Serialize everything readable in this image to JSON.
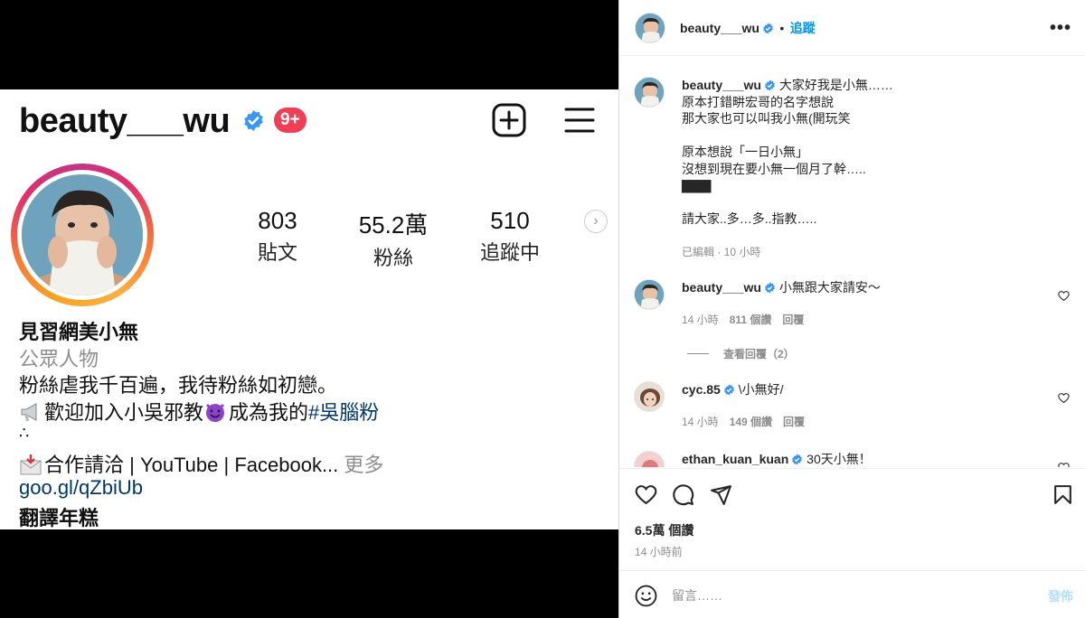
{
  "profile": {
    "username": "beauty___wu",
    "notifications": "9+",
    "stats": [
      {
        "value": "803",
        "label": "貼文"
      },
      {
        "value": "55.2萬",
        "label": "粉絲"
      },
      {
        "value": "510",
        "label": "追蹤中"
      }
    ],
    "display_name": "見習網美小無",
    "category": "公眾人物",
    "bio_line1": "粉絲虐我千百遍，我待粉絲如初戀。",
    "bio_line2_text": "歡迎加入小吳邪教",
    "bio_line2_text2": "成為我的",
    "bio_hashtag": "#吳腦粉",
    "bio_line3": "∴",
    "bio_line4_text": "合作請洽 | YouTube | Facebook...",
    "bio_more": " 更多",
    "link": "goo.gl/qZbiUb",
    "translate": "翻譯年糕",
    "next_arrow": "›"
  },
  "post": {
    "header": {
      "username": "beauty___wu",
      "follow": "追蹤",
      "more": "•••"
    },
    "caption": {
      "username": "beauty___wu",
      "text": "大家好我是小無……\n原本打錯畊宏哥的名字想說\n那大家也可以叫我小無(開玩笑\n\n原本想說「一日小無」\n沒想到現在要小無一個月了幹…..\n▇▇▇\n\n請大家..多…多..指教…..",
      "meta": "已編輯 · 10 小時"
    },
    "comments": [
      {
        "username": "beauty___wu",
        "verified": true,
        "text": "小無跟大家請安～",
        "time": "14 小時",
        "likes": "811 個讚",
        "reply": "回覆",
        "view_replies": "查看回覆（2）"
      },
      {
        "username": "cyc.85",
        "verified": true,
        "text": "\\小無好/",
        "time": "14 小時",
        "likes": "149 個讚",
        "reply": "回覆"
      },
      {
        "username": "ethan_kuan_kuan",
        "verified": true,
        "text": "30天小無！"
      }
    ],
    "likes_count": "6.5萬 個讚",
    "time_ago": "14 小時前",
    "comment_placeholder": "留言……",
    "post_button": "發佈"
  },
  "colors": {
    "accent": "#0095f6",
    "verified": "#3897f0",
    "badge": "#ef3e55",
    "link": "#00376b"
  }
}
